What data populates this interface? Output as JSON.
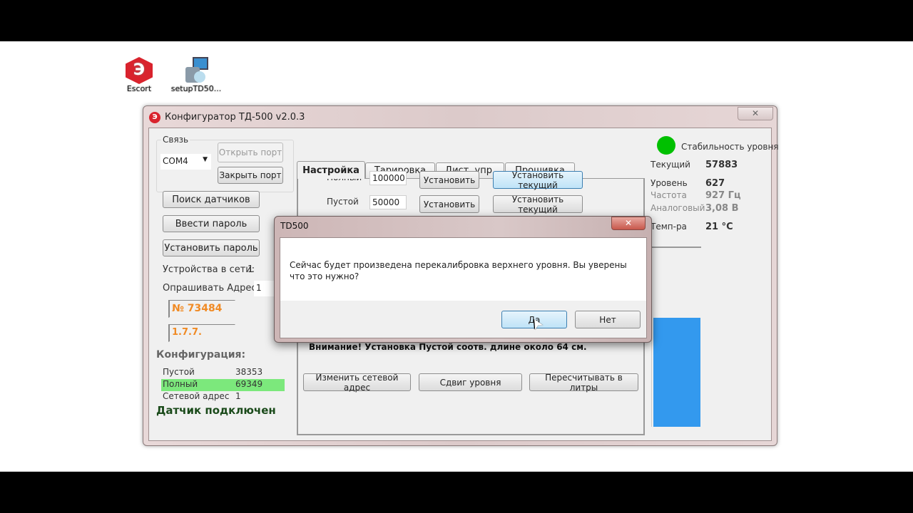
{
  "desktop": {
    "icons": [
      {
        "label": "Escort",
        "icon": "escort-app-icon"
      },
      {
        "label": "setupTD50...",
        "icon": "installer-icon"
      }
    ]
  },
  "window": {
    "title": "Конфигуратор ТД-500 v2.0.3",
    "connection": {
      "group_label": "Связь",
      "port_value": "COM4",
      "open_port": "Открыть порт",
      "close_port": "Закрыть порт"
    },
    "buttons": {
      "search": "Поиск датчиков",
      "enter_password": "Ввести пароль",
      "set_password": "Установить пароль"
    },
    "devices_label": "Устройства в сети:",
    "devices_value": "1",
    "poll_label": "Опрашивать Адрес",
    "poll_value": "1",
    "serial": "№ 73484",
    "version": "1.7.7.",
    "config": {
      "title": "Конфигурация:",
      "rows": [
        {
          "label": "Пустой",
          "value": "38353"
        },
        {
          "label": "Полный",
          "value": "69349"
        },
        {
          "label": "Сетевой адрес",
          "value": "1"
        }
      ]
    },
    "status": "Датчик подключен",
    "tabs": [
      "Настройка",
      "Тарировка",
      "Дист. упр.",
      "Прошивка"
    ],
    "settings": {
      "full_label": "Полный",
      "full_value": "100000",
      "empty_label": "Пустой",
      "empty_value": "50000",
      "set": "Установить",
      "set_current": "Установить текущий",
      "warning": "Внимание! Установка Пустой соотв. длине около 64 см.",
      "change_address": "Изменить сетевой адрес",
      "level_shift": "Сдвиг уровня",
      "recalc_liters": "Пересчитывать в литры"
    },
    "readings": {
      "stability": "Стабильность уровня",
      "stability_color": "#00c000",
      "rows": [
        {
          "label": "Текущий",
          "value": "57883"
        },
        {
          "label": "Уровень",
          "value": "627"
        },
        {
          "label": "Частота",
          "value": "927 Гц"
        },
        {
          "label": "Аналоговый",
          "value": "3,08 В"
        },
        {
          "label": "Темп-ра",
          "value": "21 °C"
        }
      ],
      "level_fill": 0.61,
      "level_color": "#3399ee"
    }
  },
  "dialog": {
    "title": "TD500",
    "message": "Сейчас будет произведена перекалибровка верхнего уровня. Вы уверены что это нужно?",
    "yes": "Да",
    "no": "Нет"
  }
}
